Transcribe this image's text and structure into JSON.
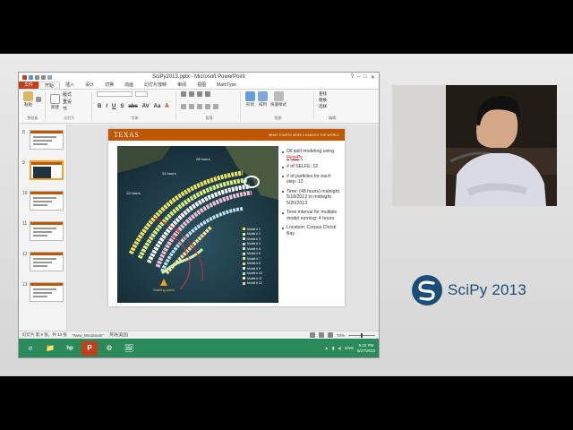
{
  "window": {
    "title": "SciPy2013.pptx - Microsoft PowerPoint"
  },
  "ribbon": {
    "tabs": [
      "文件",
      "开始",
      "插入",
      "设计",
      "切换",
      "动画",
      "幻灯片放映",
      "审阅",
      "视图",
      "MathType"
    ],
    "active_tab": "开始",
    "groups": [
      {
        "label": "剪贴板",
        "buttons": [
          "粘贴"
        ]
      },
      {
        "label": "幻灯片",
        "buttons": [
          "新建",
          "幻灯片",
          "版式",
          "重设",
          "节"
        ]
      },
      {
        "label": "字体",
        "buttons": [
          "B",
          "I",
          "U",
          "S",
          "abc",
          "AV",
          "Aa",
          "A"
        ]
      },
      {
        "label": "段落",
        "buttons": []
      },
      {
        "label": "绘图",
        "buttons": [
          "形状",
          "排列",
          "快速样式"
        ]
      },
      {
        "label": "编辑",
        "buttons": [
          "查找",
          "替换",
          "选择"
        ]
      }
    ]
  },
  "thumbnails": [
    {
      "num": "8"
    },
    {
      "num": "9",
      "selected": true
    },
    {
      "num": "10"
    },
    {
      "num": "11"
    },
    {
      "num": "12"
    },
    {
      "num": "13"
    }
  ],
  "slide": {
    "logo": "TEXAS",
    "tagline": "WHAT STARTS HERE CHANGES THE WORLD",
    "bullets": [
      {
        "pre": "Oil spill modeling using ",
        "link": "HyosPy"
      },
      {
        "pre": "# of SELFE: 12"
      },
      {
        "pre": "# of particles for each step: 13"
      },
      {
        "pre": "Time: (48 hours) midnight 5/18/2013 to midnight 5/20/2013"
      },
      {
        "pre": "Time interval for multiple model running: 4 hours"
      },
      {
        "pre": "Location: Corpus Christi Bay"
      }
    ],
    "map": {
      "labels": [
        "28 hours",
        "24 hours",
        "12 hours",
        "Starting point"
      ],
      "legend": [
        "Model # 1",
        "Model # 2",
        "Model # 3",
        "Model # 4",
        "Model # 5",
        "Model # 6",
        "Model # 7",
        "Model # 8",
        "Model # 9",
        "Model # 10",
        "Model # 11",
        "Model # 12"
      ],
      "legend_colors": [
        "#f0e060",
        "#e0f080",
        "#ffffff",
        "#f0c0d0",
        "#c0e0f0",
        "#ffe0a0",
        "#d0f0b0",
        "#f0d080",
        "#e8e8e8",
        "#b0f0c0",
        "#f8f8c0",
        "#ffd0a0"
      ]
    }
  },
  "status": {
    "left": "幻灯片 第 9 张，共 13 张",
    "theme": "\"New_Wordmark\"",
    "lang": "英语(美国)",
    "zoom": "70%"
  },
  "taskbar": {
    "apps": [
      "e",
      "📁",
      "hp",
      "P",
      "⚙",
      "🖼"
    ],
    "tray_lang": "ENG",
    "time": "6:22 PM",
    "date": "6/27/2013"
  },
  "branding": {
    "logo_text": "SciPy 2013"
  },
  "colors": {
    "texas_orange": "#bf5700",
    "taskbar": "#2a8a5a",
    "scipy_blue": "#1c4d77"
  }
}
